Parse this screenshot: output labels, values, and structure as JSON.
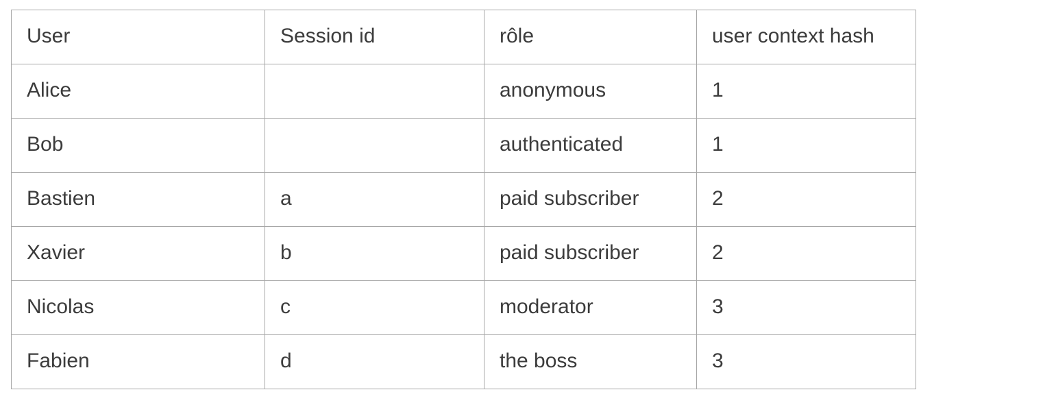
{
  "table": {
    "headers": {
      "user": "User",
      "session_id": "Session id",
      "role": "rôle",
      "hash": "user context hash"
    },
    "rows": [
      {
        "user": "Alice",
        "session_id": "",
        "role": " anonymous",
        "hash": "1"
      },
      {
        "user": "Bob",
        "session_id": "",
        "role": " authenticated",
        "hash": "1"
      },
      {
        "user": "Bastien",
        "session_id": "a",
        "role": "paid subscriber",
        "hash": "2"
      },
      {
        "user": "Xavier",
        "session_id": "b",
        "role": "paid subscriber",
        "hash": "2"
      },
      {
        "user": "Nicolas",
        "session_id": "c",
        "role": "moderator",
        "hash": "3"
      },
      {
        "user": "Fabien",
        "session_id": "d",
        "role": "the boss",
        "hash": "3"
      }
    ]
  }
}
